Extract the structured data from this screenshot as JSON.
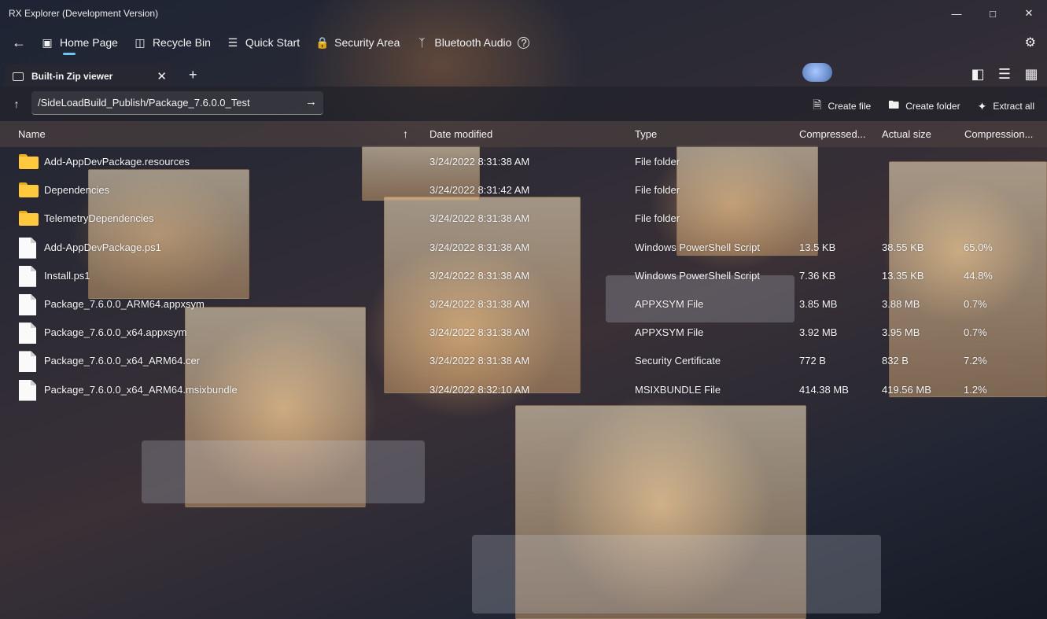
{
  "window": {
    "title": "RX Explorer (Development Version)"
  },
  "nav": {
    "items": [
      {
        "label": "Home Page",
        "icon": "home-page-icon",
        "active": true
      },
      {
        "label": "Recycle Bin",
        "icon": "recycle-bin-icon"
      },
      {
        "label": "Quick Start",
        "icon": "quick-start-icon"
      },
      {
        "label": "Security Area",
        "icon": "security-area-icon"
      },
      {
        "label": "Bluetooth Audio",
        "icon": "bluetooth-icon"
      }
    ]
  },
  "tab": {
    "label": "Built-in Zip viewer"
  },
  "address": {
    "path": "/SideLoadBuild_Publish/Package_7.6.0.0_Test"
  },
  "commands": {
    "create_file": "Create file",
    "create_folder": "Create folder",
    "extract_all": "Extract all"
  },
  "columns": {
    "name": "Name",
    "date": "Date modified",
    "type": "Type",
    "compressed": "Compressed...",
    "actual": "Actual size",
    "ratio": "Compression..."
  },
  "files": [
    {
      "kind": "folder",
      "name": "Add-AppDevPackage.resources",
      "date": "3/24/2022 8:31:38 AM",
      "type": "File folder",
      "compressed": "",
      "actual": "",
      "ratio": ""
    },
    {
      "kind": "folder",
      "name": "Dependencies",
      "date": "3/24/2022 8:31:42 AM",
      "type": "File folder",
      "compressed": "",
      "actual": "",
      "ratio": ""
    },
    {
      "kind": "folder",
      "name": "TelemetryDependencies",
      "date": "3/24/2022 8:31:38 AM",
      "type": "File folder",
      "compressed": "",
      "actual": "",
      "ratio": ""
    },
    {
      "kind": "file",
      "name": "Add-AppDevPackage.ps1",
      "date": "3/24/2022 8:31:38 AM",
      "type": "Windows PowerShell Script",
      "compressed": "13.5 KB",
      "actual": "38.55 KB",
      "ratio": "65.0%"
    },
    {
      "kind": "file",
      "name": "Install.ps1",
      "date": "3/24/2022 8:31:38 AM",
      "type": "Windows PowerShell Script",
      "compressed": "7.36 KB",
      "actual": "13.35 KB",
      "ratio": "44.8%"
    },
    {
      "kind": "file",
      "name": "Package_7.6.0.0_ARM64.appxsym",
      "date": "3/24/2022 8:31:38 AM",
      "type": "APPXSYM File",
      "compressed": "3.85 MB",
      "actual": "3.88 MB",
      "ratio": "0.7%"
    },
    {
      "kind": "file",
      "name": "Package_7.6.0.0_x64.appxsym",
      "date": "3/24/2022 8:31:38 AM",
      "type": "APPXSYM File",
      "compressed": "3.92 MB",
      "actual": "3.95 MB",
      "ratio": "0.7%"
    },
    {
      "kind": "file",
      "name": "Package_7.6.0.0_x64_ARM64.cer",
      "date": "3/24/2022 8:31:38 AM",
      "type": "Security Certificate",
      "compressed": "772 B",
      "actual": "832 B",
      "ratio": "7.2%"
    },
    {
      "kind": "file",
      "name": "Package_7.6.0.0_x64_ARM64.msixbundle",
      "date": "3/24/2022 8:32:10 AM",
      "type": "MSIXBUNDLE File",
      "compressed": "414.38 MB",
      "actual": "419.56 MB",
      "ratio": "1.2%"
    }
  ]
}
